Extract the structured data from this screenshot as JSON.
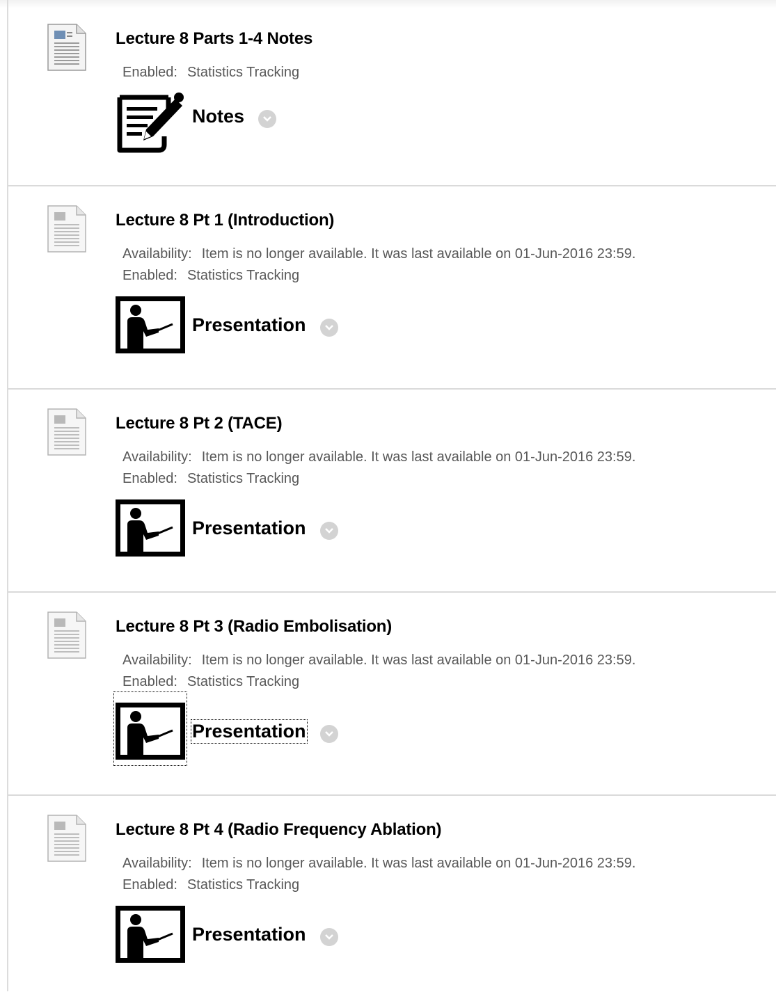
{
  "meta_labels": {
    "availability": "Availability:",
    "enabled": "Enabled:"
  },
  "items": [
    {
      "title": "Lecture 8 Parts 1-4 Notes",
      "availability": null,
      "enabled": "Statistics Tracking",
      "media_label": "Notes",
      "media_icon": "notes-pencil-icon"
    },
    {
      "title": "Lecture 8 Pt 1 (Introduction)",
      "availability": "Item is no longer available. It was last available on 01-Jun-2016 23:59.",
      "enabled": "Statistics Tracking",
      "media_label": "Presentation",
      "media_icon": "presentation-icon"
    },
    {
      "title": "Lecture 8 Pt 2 (TACE)",
      "availability": "Item is no longer available. It was last available on 01-Jun-2016 23:59.",
      "enabled": "Statistics Tracking",
      "media_label": "Presentation",
      "media_icon": "presentation-icon"
    },
    {
      "title": "Lecture 8 Pt 3 (Radio Embolisation)",
      "availability": "Item is no longer available. It was last available on 01-Jun-2016 23:59.",
      "enabled": "Statistics Tracking",
      "media_label": "Presentation",
      "media_icon": "presentation-icon",
      "focused": true
    },
    {
      "title": "Lecture 8 Pt 4 (Radio Frequency Ablation)",
      "availability": "Item is no longer available. It was last available on 01-Jun-2016 23:59.",
      "enabled": "Statistics Tracking",
      "media_label": "Presentation",
      "media_icon": "presentation-icon"
    }
  ]
}
